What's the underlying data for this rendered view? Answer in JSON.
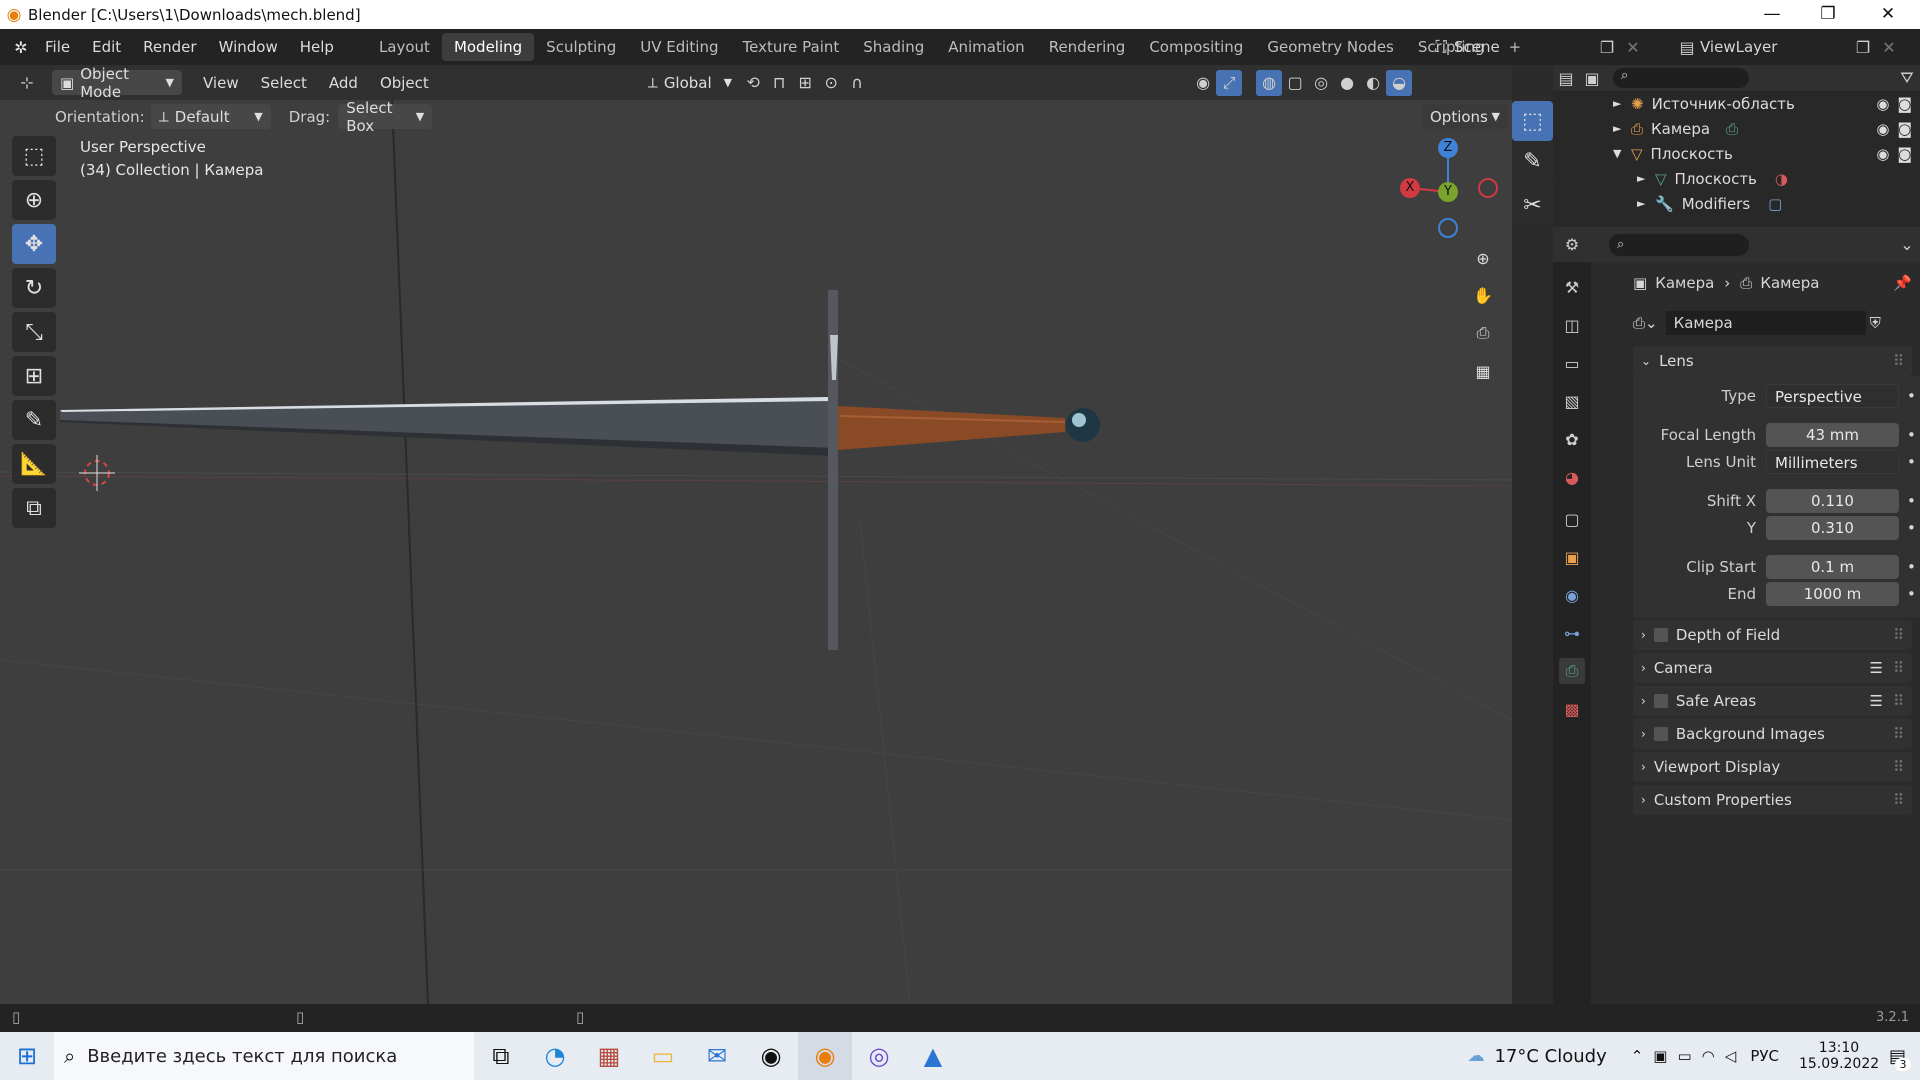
{
  "window": {
    "title": "Blender [C:\\Users\\1\\Downloads\\mech.blend]"
  },
  "menu": [
    "File",
    "Edit",
    "Render",
    "Window",
    "Help"
  ],
  "workspaces": [
    "Layout",
    "Modeling",
    "Sculpting",
    "UV Editing",
    "Texture Paint",
    "Shading",
    "Animation",
    "Rendering",
    "Compositing",
    "Geometry Nodes",
    "Scripting"
  ],
  "active_workspace": "Modeling",
  "add_workspace": "+",
  "scene": "Scene",
  "view_layer": "ViewLayer",
  "header": {
    "mode": "Object Mode",
    "menus": [
      "View",
      "Select",
      "Add",
      "Object"
    ],
    "transform": "Global"
  },
  "toolheader": {
    "orientation_label": "Orientation:",
    "orientation": "Default",
    "drag_label": "Drag:",
    "drag": "Select Box",
    "options": "Options"
  },
  "viewport": {
    "perspective": "User Perspective",
    "collection": "(34) Collection | Камера",
    "gizmo": {
      "z": "Z",
      "y": "Y",
      "x": "X"
    }
  },
  "outliner": {
    "items": [
      "Источник-область",
      "Камера",
      "Плоскость",
      "Плоскость",
      "Modifiers"
    ]
  },
  "properties": {
    "breadcrumb_object": "Камера",
    "breadcrumb_data": "Камера",
    "data_name": "Камера",
    "lens_panel": "Lens",
    "fields": {
      "type_label": "Type",
      "type": "Perspective",
      "focal_label": "Focal Length",
      "focal": "43 mm",
      "unit_label": "Lens Unit",
      "unit": "Millimeters",
      "shiftx_label": "Shift X",
      "shiftx": "0.110",
      "shifty_label": "Y",
      "shifty": "0.310",
      "clipstart_label": "Clip Start",
      "clipstart": "0.1 m",
      "clipend_label": "End",
      "clipend": "1000 m"
    },
    "panels": [
      "Depth of Field",
      "Camera",
      "Safe Areas",
      "Background Images",
      "Viewport Display",
      "Custom Properties"
    ]
  },
  "status": {
    "version": "3.2.1"
  },
  "taskbar": {
    "search_placeholder": "Введите здесь текст для поиска",
    "weather": "17°C  Cloudy",
    "lang": "РУС",
    "time": "13:10",
    "date": "15.09.2022",
    "notifications": "3"
  },
  "colors": {
    "accent": "#4772b3",
    "x_axis": "#d13a42",
    "y_axis": "#7aa32d",
    "z_axis": "#3e83d8",
    "handle": "#8a4a26"
  }
}
